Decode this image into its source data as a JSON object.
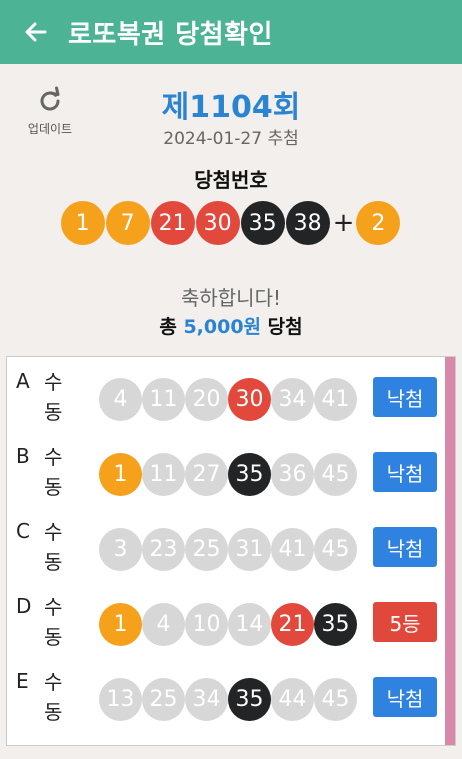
{
  "header": {
    "title": "로또복권 당첨확인"
  },
  "update": {
    "label": "업데이트"
  },
  "draw": {
    "round": "제1104회",
    "date": "2024-01-27 추첨",
    "label": "당첨번호",
    "numbers": [
      1,
      7,
      21,
      30,
      35,
      38
    ],
    "plus": "+",
    "bonus": 2
  },
  "result": {
    "message": "축하합니다!",
    "prize_prefix": "총",
    "prize_amount": "5,000원",
    "prize_suffix": "당첨"
  },
  "colors": {
    "yellow": "#f5a11c",
    "red": "#e2483b",
    "black": "#222426",
    "gray": "#d7d7d7",
    "blue": "#2f82e0",
    "loss_badge": "#2f82e0",
    "win_badge": "#e0483c"
  },
  "tickets": [
    {
      "letter": "A",
      "mode": "수동",
      "numbers": [
        4,
        11,
        20,
        30,
        34,
        41
      ],
      "status": "낙첨"
    },
    {
      "letter": "B",
      "mode": "수동",
      "numbers": [
        1,
        11,
        27,
        35,
        36,
        45
      ],
      "status": "낙첨"
    },
    {
      "letter": "C",
      "mode": "수동",
      "numbers": [
        3,
        23,
        25,
        31,
        41,
        45
      ],
      "status": "낙첨"
    },
    {
      "letter": "D",
      "mode": "수동",
      "numbers": [
        1,
        4,
        10,
        14,
        21,
        35
      ],
      "status": "5등"
    },
    {
      "letter": "E",
      "mode": "수동",
      "numbers": [
        13,
        25,
        34,
        35,
        44,
        45
      ],
      "status": "낙첨"
    }
  ]
}
